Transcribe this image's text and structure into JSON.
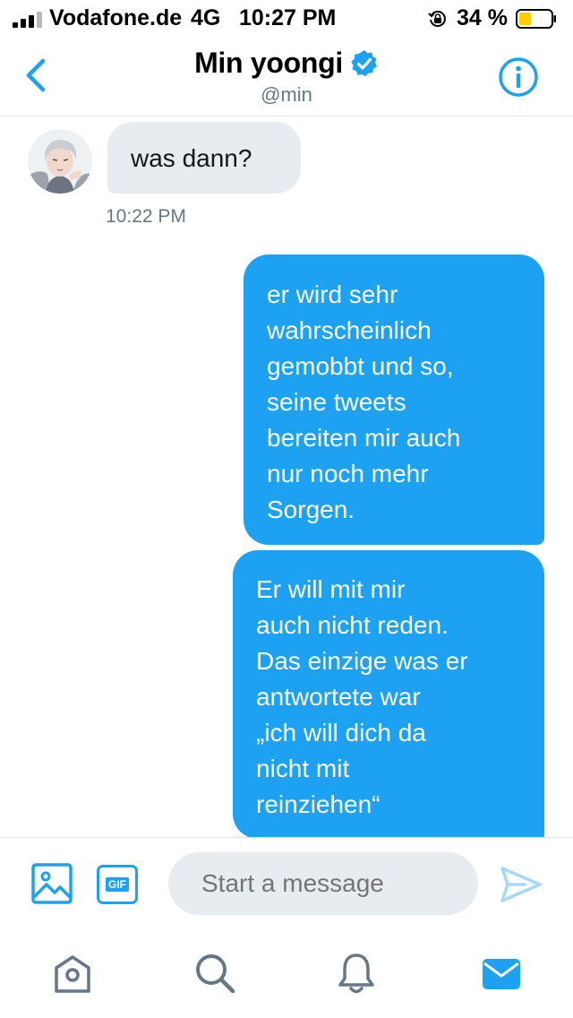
{
  "status_bar": {
    "carrier": "Vodafone.de",
    "network": "4G",
    "time": "10:27 PM",
    "battery_percent": "34 %"
  },
  "header": {
    "display_name": "Min yoongi",
    "handle": "@min",
    "verified": true
  },
  "conversation": {
    "incoming": {
      "text": "was dann?",
      "timestamp": "10:22 PM"
    },
    "outgoing": [
      {
        "lines": [
          "er wird sehr",
          "wahrscheinlich",
          "gemobbt und so,",
          "seine tweets",
          "bereiten mir auch",
          "nur noch mehr",
          "Sorgen."
        ]
      },
      {
        "lines": [
          "Er will mit mir",
          "auch nicht reden.",
          "Das einzige was er",
          "antwortete war",
          "„ich will dich da",
          "nicht mit",
          "reinziehen“"
        ]
      }
    ]
  },
  "composer": {
    "placeholder": "Start a message",
    "gif_label": "GIF"
  },
  "tabs": [
    "home",
    "search",
    "notifications",
    "messages"
  ],
  "colors": {
    "accent": "#1da1f2",
    "bubble_incoming": "#e6ecf0",
    "secondary_text": "#657786",
    "battery_fill": "#ffcc00",
    "tab_inactive": "#657786"
  }
}
